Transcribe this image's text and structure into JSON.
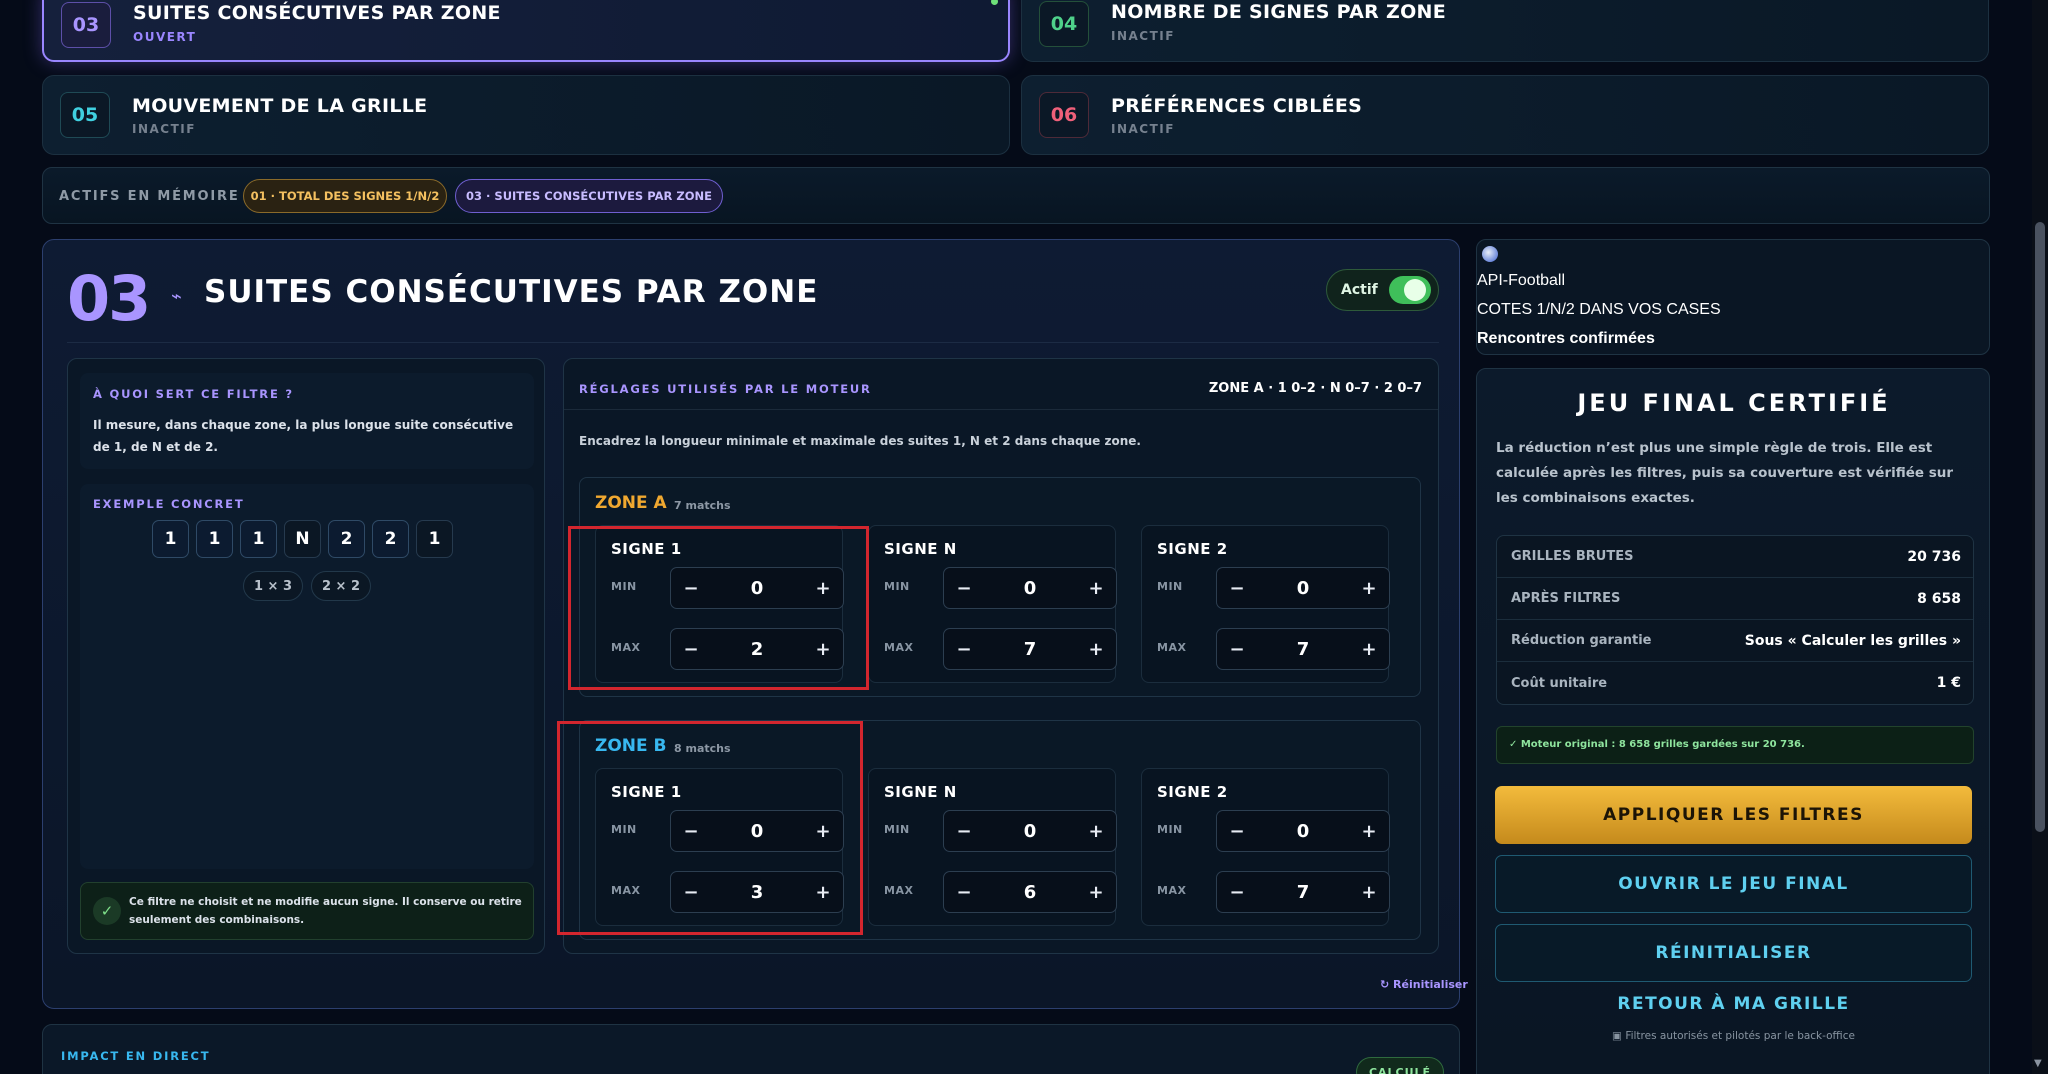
{
  "filters": [
    {
      "num": "03",
      "title": "SUITES CONSÉCUTIVES PAR ZONE",
      "status": "OUVERT",
      "color": "#a995ff"
    },
    {
      "num": "04",
      "title": "NOMBRE DE SIGNES PAR ZONE",
      "status": "INACTIF",
      "color": "#4fd18a"
    },
    {
      "num": "05",
      "title": "MOUVEMENT DE LA GRILLE",
      "status": "INACTIF",
      "color": "#40d0e0"
    },
    {
      "num": "06",
      "title": "PRÉFÉRENCES CIBLÉES",
      "status": "INACTIF",
      "color": "#f0607a"
    }
  ],
  "memory": {
    "label": "ACTIFS EN MÉMOIRE",
    "chips": [
      "01 · TOTAL DES SIGNES 1/N/2",
      "03 · SUITES CONSÉCUTIVES PAR ZONE"
    ]
  },
  "panel": {
    "num": "03",
    "title": "SUITES CONSÉCUTIVES PAR ZONE",
    "toggle_label": "Actif",
    "toggle_on": true,
    "info_title": "À QUOI SERT CE FILTRE ?",
    "info_text": "Il mesure, dans chaque zone, la plus longue suite consécutive de 1, de N et de 2.",
    "example_title": "EXEMPLE CONCRET",
    "example_chain": [
      "1",
      "1",
      "1",
      "N",
      "2",
      "2",
      "1"
    ],
    "example_runs": [
      "1 × 3",
      "2 × 2"
    ],
    "note": "Ce filtre ne choisit et ne modifie aucun signe. Il conserve ou retire seulement des combinaisons.",
    "settings_title": "RÉGLAGES UTILISÉS PAR LE MOTEUR",
    "settings_summary": "ZONE A · 1 0–2 · N 0–7 · 2 0–7",
    "settings_desc": "Encadrez la longueur minimale et maximale des suites 1, N et 2 dans chaque zone.",
    "min_label": "MIN",
    "max_label": "MAX",
    "zones": [
      {
        "name": "ZONE A",
        "count": "7 matchs",
        "color": "#f0a830",
        "signs": [
          {
            "label": "SIGNE 1",
            "min": "0",
            "max": "2"
          },
          {
            "label": "SIGNE N",
            "min": "0",
            "max": "7"
          },
          {
            "label": "SIGNE 2",
            "min": "0",
            "max": "7"
          }
        ]
      },
      {
        "name": "ZONE B",
        "count": "8 matchs",
        "color": "#38b8f0",
        "signs": [
          {
            "label": "SIGNE 1",
            "min": "0",
            "max": "3"
          },
          {
            "label": "SIGNE N",
            "min": "0",
            "max": "6"
          },
          {
            "label": "SIGNE 2",
            "min": "0",
            "max": "7"
          }
        ]
      }
    ],
    "reset_link": "↻ Réinitialiser"
  },
  "impact": {
    "title": "IMPACT EN DIRECT",
    "badge": "CALCULÉ"
  },
  "api": {
    "provider": "API-Football",
    "line1": "COTES 1/N/2 DANS VOS CASES",
    "line2": "Rencontres confirmées"
  },
  "final": {
    "title": "JEU FINAL CERTIFIÉ",
    "desc": "La réduction n’est plus une simple règle de trois. Elle est calculée après les filtres, puis sa couverture est vérifiée sur les combinaisons exactes.",
    "stats": [
      {
        "k": "GRILLES BRUTES",
        "v": "20 736"
      },
      {
        "k": "APRÈS FILTRES",
        "v": "8 658"
      },
      {
        "k": "Réduction garantie",
        "v": "Sous « Calculer les grilles »"
      },
      {
        "k": "Coût unitaire",
        "v": "1 €"
      }
    ],
    "engine_note": "✓ Moteur original : 8 658 grilles gardées sur 20 736.",
    "apply": "APPLIQUER LES FILTRES",
    "open": "OUVRIR LE JEU FINAL",
    "reset": "RÉINITIALISER",
    "back": "RETOUR À MA GRILLE",
    "footer": "Filtres autorisés et pilotés par le back-office"
  },
  "colors": {
    "accent": "#a995ff",
    "gold": "#f0a830",
    "blue": "#38b8f0",
    "green": "#4fd18a"
  }
}
